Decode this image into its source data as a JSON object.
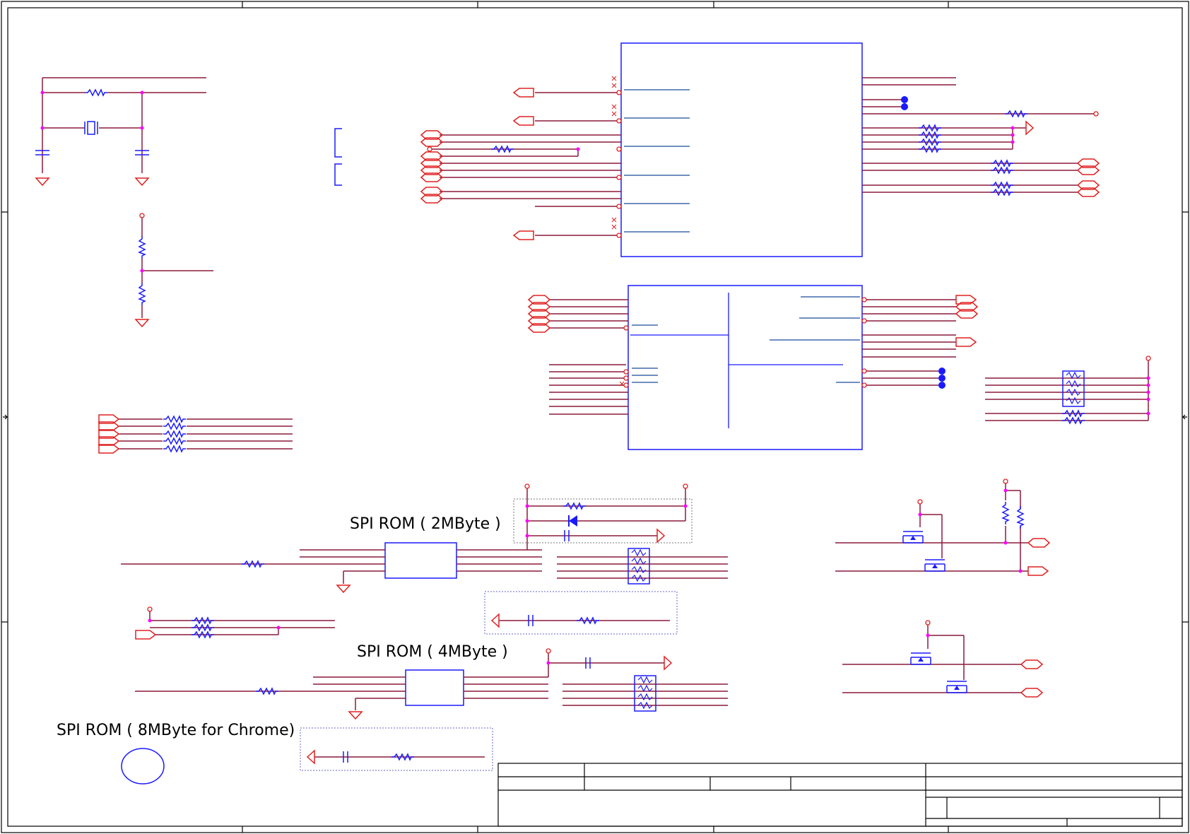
{
  "labels": {
    "spi_rom_2mb": "SPI ROM ( 2MByte )",
    "spi_rom_4mb": "SPI ROM ( 4MByte )",
    "spi_rom_8mb": "SPI ROM ( 8MByte for Chrome)"
  },
  "colors": {
    "wire": "#8b1a3a",
    "net": "#e02020",
    "component": "#1a1aff",
    "junction": "#ff00ff",
    "frame": "#000000",
    "dotted_box": "#6666cc"
  }
}
